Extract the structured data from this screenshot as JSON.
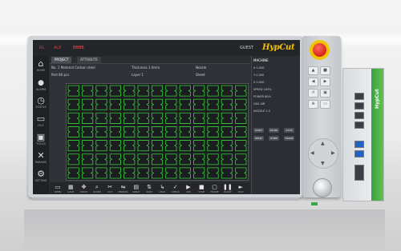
{
  "hmi": {
    "brand": "HypCut",
    "topbar": {
      "status_items": [
        "RL",
        "ALE",
        "BBBB"
      ],
      "user": "GUEST"
    },
    "tabs": [
      "PROJECT",
      "ATTRIBUTE"
    ],
    "info_rows": [
      [
        "No. 1  Material  Carbon steel",
        "Thickness  1.0mm",
        "Nozzle"
      ],
      [
        "Part  80  pcs",
        "Layer  1",
        "Sheet"
      ]
    ],
    "sidebar": [
      {
        "icon": "home-icon",
        "glyph": "⌂",
        "label": "HOME"
      },
      {
        "icon": "bell-icon",
        "glyph": "🔔",
        "label": "ALARM"
      },
      {
        "icon": "gauge-icon",
        "glyph": "◷",
        "label": "STATUS"
      },
      {
        "icon": "folder-icon",
        "glyph": "▭",
        "label": "FILE"
      },
      {
        "icon": "toolbox-icon",
        "glyph": "▣",
        "label": "TOOLS"
      },
      {
        "icon": "wrench-icon",
        "glyph": "✕",
        "label": "PARAMS"
      },
      {
        "icon": "gear-icon",
        "glyph": "⚙",
        "label": "SETTING"
      }
    ],
    "bottom_tools": [
      "OPEN",
      "SAVE",
      "MOVE",
      "ZOOM",
      "CUT",
      "MIRROR",
      "ARRAY",
      "SORT",
      "LEAD",
      "CHECK",
      "SIM",
      "STOP",
      "FRAME",
      "PAUSE",
      "RUN"
    ],
    "right_panel": {
      "title": "MACHINE",
      "rows": [
        "X  0.000",
        "Y  0.000",
        "Z  0.000",
        "SPEED  100%",
        "POWER  80%",
        "GAS  AIR",
        "NOZZLE  1.5"
      ],
      "buttons": [
        "START",
        "PAUSE",
        "STOP",
        "RESET",
        "HOME",
        "FRAME"
      ]
    }
  },
  "grid": {
    "rows": 7,
    "cols": 13
  }
}
